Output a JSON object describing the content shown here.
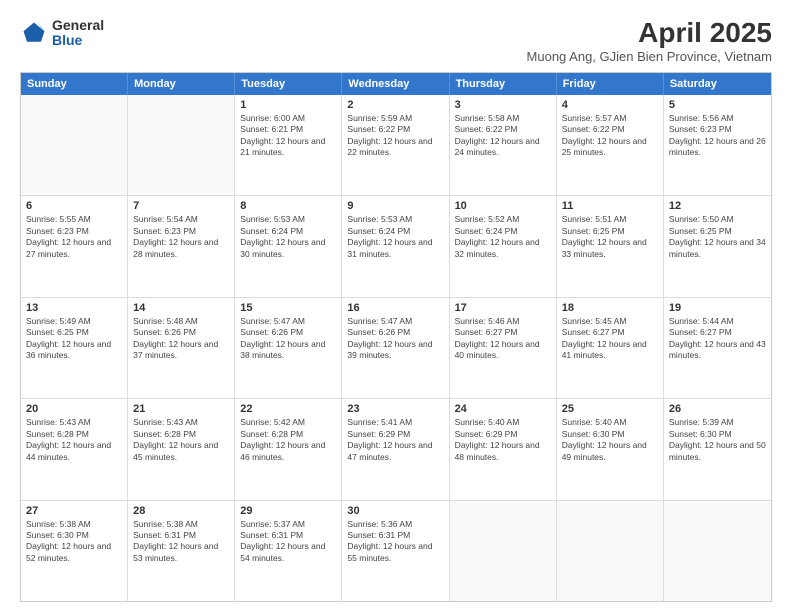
{
  "header": {
    "logo_general": "General",
    "logo_blue": "Blue",
    "title": "April 2025",
    "subtitle": "Muong Ang, GJien Bien Province, Vietnam"
  },
  "calendar": {
    "days": [
      "Sunday",
      "Monday",
      "Tuesday",
      "Wednesday",
      "Thursday",
      "Friday",
      "Saturday"
    ],
    "weeks": [
      [
        {
          "day": "",
          "info": ""
        },
        {
          "day": "",
          "info": ""
        },
        {
          "day": "1",
          "info": "Sunrise: 6:00 AM\nSunset: 6:21 PM\nDaylight: 12 hours and 21 minutes."
        },
        {
          "day": "2",
          "info": "Sunrise: 5:59 AM\nSunset: 6:22 PM\nDaylight: 12 hours and 22 minutes."
        },
        {
          "day": "3",
          "info": "Sunrise: 5:58 AM\nSunset: 6:22 PM\nDaylight: 12 hours and 24 minutes."
        },
        {
          "day": "4",
          "info": "Sunrise: 5:57 AM\nSunset: 6:22 PM\nDaylight: 12 hours and 25 minutes."
        },
        {
          "day": "5",
          "info": "Sunrise: 5:56 AM\nSunset: 6:23 PM\nDaylight: 12 hours and 26 minutes."
        }
      ],
      [
        {
          "day": "6",
          "info": "Sunrise: 5:55 AM\nSunset: 6:23 PM\nDaylight: 12 hours and 27 minutes."
        },
        {
          "day": "7",
          "info": "Sunrise: 5:54 AM\nSunset: 6:23 PM\nDaylight: 12 hours and 28 minutes."
        },
        {
          "day": "8",
          "info": "Sunrise: 5:53 AM\nSunset: 6:24 PM\nDaylight: 12 hours and 30 minutes."
        },
        {
          "day": "9",
          "info": "Sunrise: 5:53 AM\nSunset: 6:24 PM\nDaylight: 12 hours and 31 minutes."
        },
        {
          "day": "10",
          "info": "Sunrise: 5:52 AM\nSunset: 6:24 PM\nDaylight: 12 hours and 32 minutes."
        },
        {
          "day": "11",
          "info": "Sunrise: 5:51 AM\nSunset: 6:25 PM\nDaylight: 12 hours and 33 minutes."
        },
        {
          "day": "12",
          "info": "Sunrise: 5:50 AM\nSunset: 6:25 PM\nDaylight: 12 hours and 34 minutes."
        }
      ],
      [
        {
          "day": "13",
          "info": "Sunrise: 5:49 AM\nSunset: 6:25 PM\nDaylight: 12 hours and 36 minutes."
        },
        {
          "day": "14",
          "info": "Sunrise: 5:48 AM\nSunset: 6:26 PM\nDaylight: 12 hours and 37 minutes."
        },
        {
          "day": "15",
          "info": "Sunrise: 5:47 AM\nSunset: 6:26 PM\nDaylight: 12 hours and 38 minutes."
        },
        {
          "day": "16",
          "info": "Sunrise: 5:47 AM\nSunset: 6:26 PM\nDaylight: 12 hours and 39 minutes."
        },
        {
          "day": "17",
          "info": "Sunrise: 5:46 AM\nSunset: 6:27 PM\nDaylight: 12 hours and 40 minutes."
        },
        {
          "day": "18",
          "info": "Sunrise: 5:45 AM\nSunset: 6:27 PM\nDaylight: 12 hours and 41 minutes."
        },
        {
          "day": "19",
          "info": "Sunrise: 5:44 AM\nSunset: 6:27 PM\nDaylight: 12 hours and 43 minutes."
        }
      ],
      [
        {
          "day": "20",
          "info": "Sunrise: 5:43 AM\nSunset: 6:28 PM\nDaylight: 12 hours and 44 minutes."
        },
        {
          "day": "21",
          "info": "Sunrise: 5:43 AM\nSunset: 6:28 PM\nDaylight: 12 hours and 45 minutes."
        },
        {
          "day": "22",
          "info": "Sunrise: 5:42 AM\nSunset: 6:28 PM\nDaylight: 12 hours and 46 minutes."
        },
        {
          "day": "23",
          "info": "Sunrise: 5:41 AM\nSunset: 6:29 PM\nDaylight: 12 hours and 47 minutes."
        },
        {
          "day": "24",
          "info": "Sunrise: 5:40 AM\nSunset: 6:29 PM\nDaylight: 12 hours and 48 minutes."
        },
        {
          "day": "25",
          "info": "Sunrise: 5:40 AM\nSunset: 6:30 PM\nDaylight: 12 hours and 49 minutes."
        },
        {
          "day": "26",
          "info": "Sunrise: 5:39 AM\nSunset: 6:30 PM\nDaylight: 12 hours and 50 minutes."
        }
      ],
      [
        {
          "day": "27",
          "info": "Sunrise: 5:38 AM\nSunset: 6:30 PM\nDaylight: 12 hours and 52 minutes."
        },
        {
          "day": "28",
          "info": "Sunrise: 5:38 AM\nSunset: 6:31 PM\nDaylight: 12 hours and 53 minutes."
        },
        {
          "day": "29",
          "info": "Sunrise: 5:37 AM\nSunset: 6:31 PM\nDaylight: 12 hours and 54 minutes."
        },
        {
          "day": "30",
          "info": "Sunrise: 5:36 AM\nSunset: 6:31 PM\nDaylight: 12 hours and 55 minutes."
        },
        {
          "day": "",
          "info": ""
        },
        {
          "day": "",
          "info": ""
        },
        {
          "day": "",
          "info": ""
        }
      ]
    ]
  }
}
